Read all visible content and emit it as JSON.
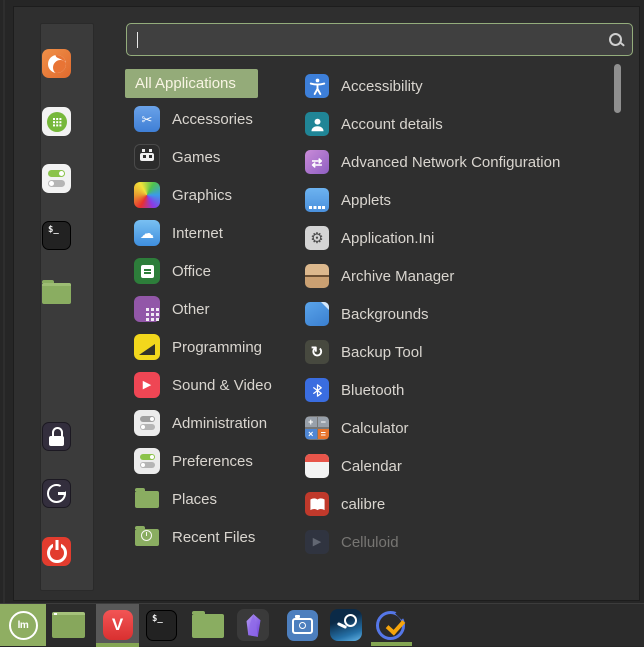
{
  "glyphs": {
    "terminal_prompt": "$_",
    "vivaldi_v": "V",
    "mint_monogram": "lm",
    "scissors": "✂",
    "cloud": "☁",
    "swap_arrows": "⇄",
    "gear": "⚙",
    "play": "▶",
    "refresh": "↻",
    "calc_plus": "+",
    "calc_minus": "−",
    "calc_times": "×",
    "calc_equals": "="
  },
  "menu": {
    "search_value": "",
    "all_applications": "All Applications",
    "categories": [
      {
        "label": "Accessories",
        "icon": "scissors-icon"
      },
      {
        "label": "Games",
        "icon": "space-invader-icon"
      },
      {
        "label": "Graphics",
        "icon": "rainbow-icon"
      },
      {
        "label": "Internet",
        "icon": "cloud-icon"
      },
      {
        "label": "Office",
        "icon": "document-icon"
      },
      {
        "label": "Other",
        "icon": "dot-grid-icon"
      },
      {
        "label": "Programming",
        "icon": "ramp-icon"
      },
      {
        "label": "Sound & Video",
        "icon": "play-icon"
      },
      {
        "label": "Administration",
        "icon": "toggles-gray-icon"
      },
      {
        "label": "Preferences",
        "icon": "toggles-green-icon"
      },
      {
        "label": "Places",
        "icon": "folder-icon"
      },
      {
        "label": "Recent Files",
        "icon": "folder-clock-icon"
      }
    ],
    "apps": [
      {
        "label": "Accessibility",
        "icon": "accessibility-icon"
      },
      {
        "label": "Account details",
        "icon": "user-icon"
      },
      {
        "label": "Advanced Network Configuration",
        "icon": "network-arrows-icon"
      },
      {
        "label": "Applets",
        "icon": "panel-applets-icon"
      },
      {
        "label": "Application.Ini",
        "icon": "gear-icon"
      },
      {
        "label": "Archive Manager",
        "icon": "archive-box-icon"
      },
      {
        "label": "Backgrounds",
        "icon": "wallpaper-icon"
      },
      {
        "label": "Backup Tool",
        "icon": "backup-ring-icon"
      },
      {
        "label": "Bluetooth",
        "icon": "bluetooth-icon"
      },
      {
        "label": "Calculator",
        "icon": "calculator-icon"
      },
      {
        "label": "Calendar",
        "icon": "calendar-icon"
      },
      {
        "label": "calibre",
        "icon": "book-icon"
      },
      {
        "label": "Celluloid",
        "icon": "media-player-icon",
        "faded": true
      }
    ]
  },
  "sidebar": {
    "items": [
      {
        "name": "firefox"
      },
      {
        "name": "software-manager"
      },
      {
        "name": "system-settings"
      },
      {
        "name": "terminal"
      },
      {
        "name": "files"
      },
      {
        "name": "lock-screen"
      },
      {
        "name": "log-out"
      },
      {
        "name": "shut-down"
      }
    ]
  },
  "panel": {
    "items": [
      {
        "name": "menu",
        "active": true
      },
      {
        "name": "show-desktop"
      },
      {
        "name": "vivaldi",
        "focused": true,
        "running": true
      },
      {
        "name": "terminal"
      },
      {
        "name": "files"
      },
      {
        "name": "obsidian"
      },
      {
        "name": "screenshot-camera"
      },
      {
        "name": "steam"
      },
      {
        "name": "todo-app",
        "running": true
      }
    ]
  },
  "colors": {
    "accent_green": "#94ab79",
    "search_border_green": "#94ad7c",
    "panel_menu_green": "#8fae62",
    "running_underline_green": "#84a653",
    "selected_text": "#f8f4e3",
    "label_text": "#d9d5cf",
    "menu_background": "#2f2f2f",
    "panel_background": "#2b2b2b"
  }
}
